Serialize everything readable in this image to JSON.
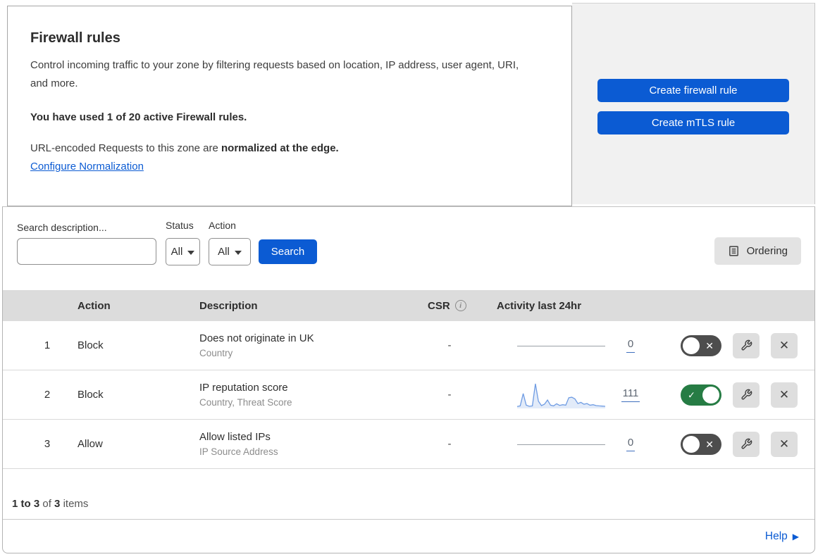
{
  "header": {
    "title": "Firewall rules",
    "description": "Control incoming traffic to your zone by filtering requests based on location, IP address, user agent, URI, and more.",
    "usage_note": "You have used 1 of 20 active Firewall rules.",
    "normalization_text": "URL-encoded Requests to this zone are ",
    "normalization_bold": "normalized at the edge.",
    "normalization_link": "Configure Normalization"
  },
  "actions_panel": {
    "create_firewall_rule": "Create firewall rule",
    "create_mtls_rule": "Create mTLS rule"
  },
  "filters": {
    "search_label": "Search description...",
    "status_label": "Status",
    "status_value": "All",
    "action_label": "Action",
    "action_value": "All",
    "search_button": "Search",
    "ordering_button": "Ordering"
  },
  "table": {
    "columns": {
      "action": "Action",
      "description": "Description",
      "csr": "CSR",
      "activity": "Activity last 24hr"
    },
    "rows": [
      {
        "priority": "1",
        "action": "Block",
        "description": "Does not originate in UK",
        "fields": "Country",
        "csr": "-",
        "activity_count": "0",
        "enabled": false,
        "sparkline": null
      },
      {
        "priority": "2",
        "action": "Block",
        "description": "IP reputation score",
        "fields": "Country, Threat Score",
        "csr": "-",
        "activity_count": "111",
        "enabled": true,
        "sparkline": [
          2,
          5,
          58,
          8,
          3,
          5,
          100,
          25,
          6,
          12,
          30,
          8,
          5,
          14,
          7,
          10,
          8,
          40,
          42,
          35,
          15,
          20,
          12,
          15,
          8,
          10,
          6,
          5,
          4,
          3
        ]
      },
      {
        "priority": "3",
        "action": "Allow",
        "description": "Allow listed IPs",
        "fields": "IP Source Address",
        "csr": "-",
        "activity_count": "0",
        "enabled": false,
        "sparkline": null
      }
    ]
  },
  "pagination": {
    "range": "1 to 3",
    "of": "of",
    "total": "3",
    "items": "items"
  },
  "footer": {
    "help_label": "Help"
  },
  "icons": {
    "toggle_on": "✓",
    "toggle_off": "✕",
    "close": "✕",
    "help_arrow": "▶"
  },
  "colors": {
    "primary_blue": "#0b5bd3",
    "toggle_on_green": "#267c44",
    "toggle_off_gray": "#4d4d4d",
    "panel_gray": "#f1f1f1",
    "table_header_gray": "#dcdcdc"
  }
}
